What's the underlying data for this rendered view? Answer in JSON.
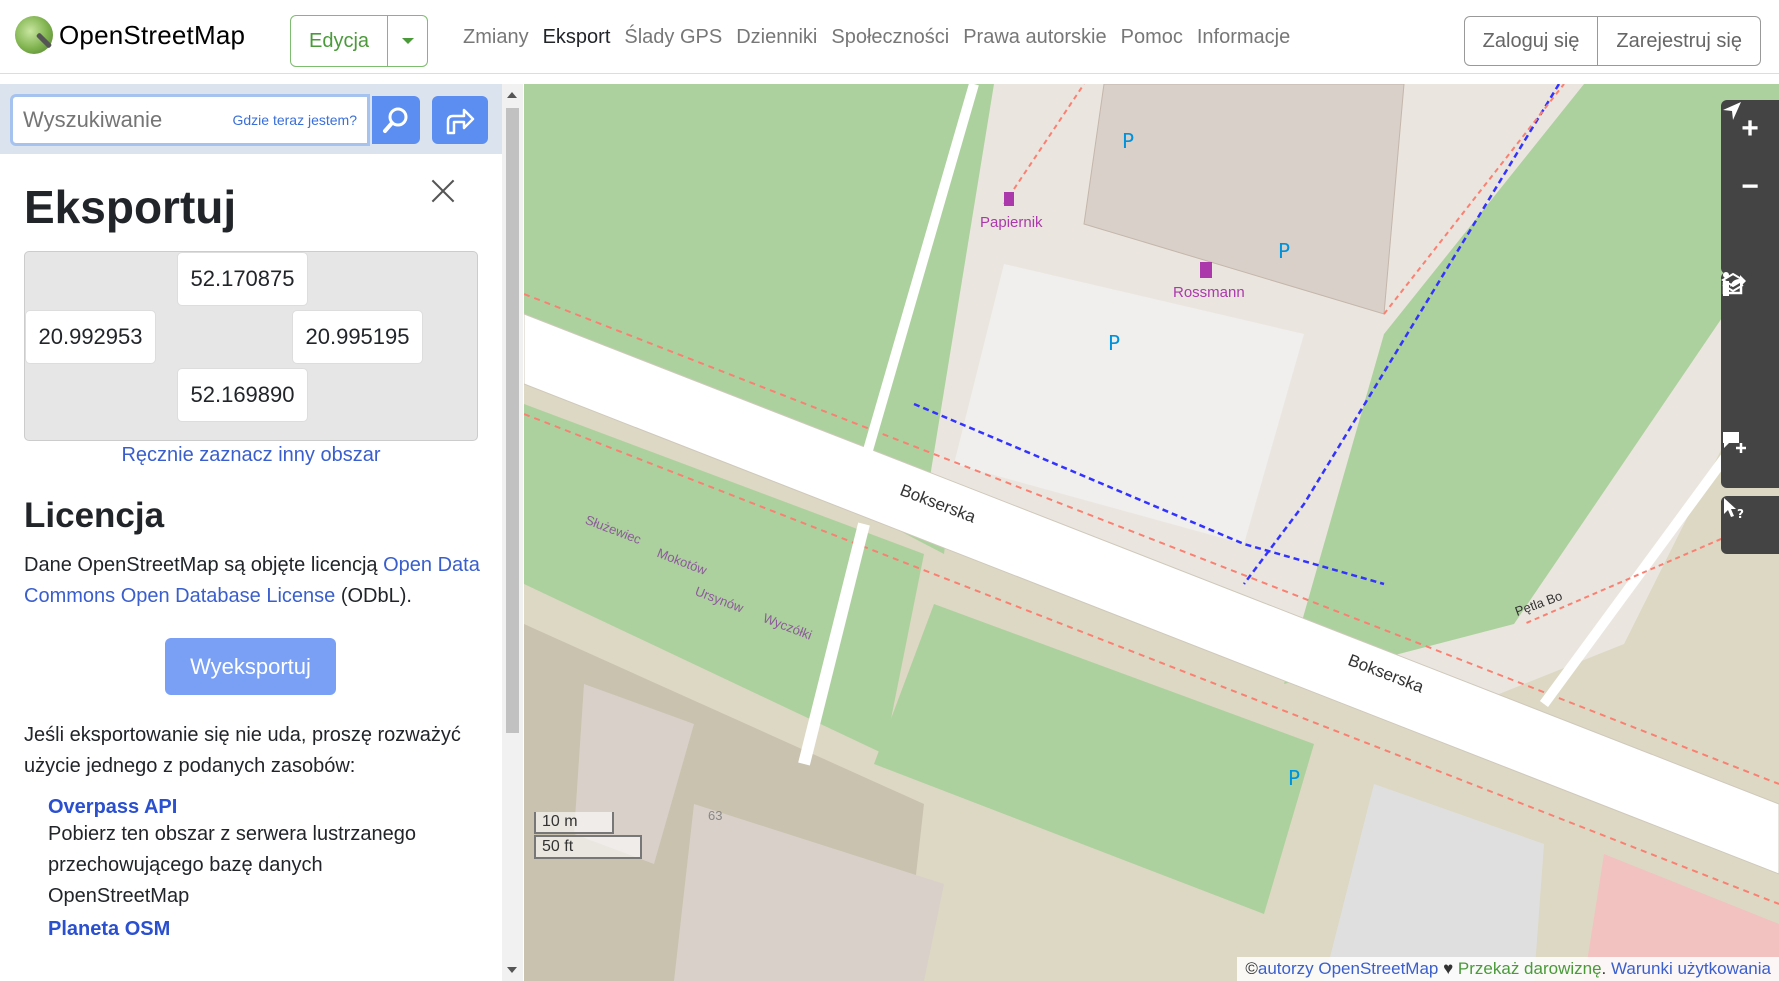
{
  "header": {
    "logo_text": "OpenStreetMap",
    "edit_label": "Edycja",
    "nav": [
      "Zmiany",
      "Eksport",
      "Ślady GPS",
      "Dzienniki",
      "Społeczności",
      "Prawa autorskie",
      "Pomoc",
      "Informacje"
    ],
    "active_nav": "Eksport",
    "login": "Zaloguj się",
    "signup": "Zarejestruj się"
  },
  "search": {
    "placeholder": "Wyszukiwanie",
    "where_am_i": "Gdzie teraz jestem?"
  },
  "export": {
    "title": "Eksportuj",
    "north": "52.170875",
    "west": "20.992953",
    "east": "20.995195",
    "south": "52.169890",
    "manual_select": "Ręcznie zaznacz inny obszar",
    "license_title": "Licencja",
    "license_text_1": "Dane OpenStreetMap są objęte licencją ",
    "license_link": "Open Data Commons Open Database License",
    "license_text_2": " (ODbL).",
    "export_button": "Wyeksportuj",
    "fail_text": "Jeśli eksportowanie się nie uda, proszę rozważyć użycie jednego z podanych zasobów:",
    "resources": [
      {
        "title": "Overpass API",
        "desc": "Pobierz ten obszar z serwera lustrzanego przechowującego bazę danych OpenStreetMap"
      },
      {
        "title": "Planeta OSM",
        "desc": ""
      }
    ]
  },
  "map": {
    "labels": {
      "papiernik": "Papiernik",
      "rossmann": "Rossmann",
      "bokserska_1": "Bokserska",
      "bokserska_2": "Bokserska",
      "sluzewiec": "Służewiec",
      "mokotow": "Mokotów",
      "ursynow": "Ursynów",
      "wyczolki": "Wyczółki",
      "petla": "Pętla Bo",
      "house_number": "63",
      "parking": "P"
    },
    "scale_m": "10 m",
    "scale_ft": "50 ft",
    "attribution": {
      "copy": "©",
      "authors": "autorzy OpenStreetMap",
      "heart": " ♥ ",
      "donate": "Przekaż darowiznę",
      "dot": ". ",
      "terms": "Warunki użytkowania"
    },
    "colors": {
      "park": "#add19e",
      "road": "#ffffff",
      "footway": "#fa8072",
      "cycleway": "#3333ff",
      "building": "#d9d0c9",
      "residential": "#e0dfdf"
    }
  }
}
